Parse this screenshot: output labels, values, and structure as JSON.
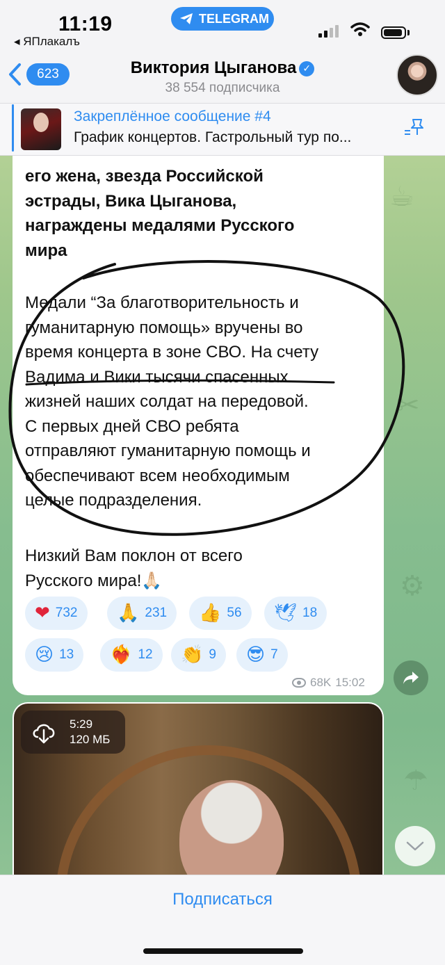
{
  "status_bar": {
    "time": "11:19",
    "back_app": "◂ ЯПлакалъ",
    "telegram_pill": "TELEGRAM"
  },
  "header": {
    "back_count": "623",
    "channel_name": "Виктория Цыганова",
    "subscribers": "38 554 подписчика"
  },
  "pinned": {
    "title": "Закреплённое сообщение #4",
    "text": "График концертов. Гастрольный тур по..."
  },
  "message": {
    "bold_lines": [
      "его жена, звезда Российской",
      "эстрады, Вика Цыганова,",
      "награждены медалями Русского",
      "мира"
    ],
    "para1_lines": [
      "Медали “За благотворительность и",
      "гуманитарную помощь» вручены во",
      "время концерта в зоне СВО. На счету",
      "Вадима и Вики тысячи спасенных",
      "жизней наших солдат на передовой.",
      "С первых дней СВО ребята",
      "отправляют гуманитарную помощь и",
      "обеспечивают всем необходимым",
      "целые подразделения."
    ],
    "para2_lines": [
      "Низкий Вам поклон от всего",
      "Русского мира!🙏🏻"
    ],
    "reactions": [
      {
        "emoji": "❤",
        "count": "732"
      },
      {
        "emoji": "🙏",
        "count": "231"
      },
      {
        "emoji": "👍",
        "count": "56"
      },
      {
        "emoji": "🕊",
        "count": "18"
      },
      {
        "emoji": "😢",
        "count": "13"
      },
      {
        "emoji": "❤‍🔥",
        "count": "12"
      },
      {
        "emoji": "👏",
        "count": "9"
      },
      {
        "emoji": "😎",
        "count": "7"
      }
    ],
    "views": "68K",
    "time": "15:02"
  },
  "video": {
    "duration": "5:29",
    "size": "120 МБ"
  },
  "bottom": {
    "subscribe_label": "Подписаться"
  },
  "colors": {
    "accent": "#2f8cf0",
    "reaction_bg": "#e6f1fc"
  }
}
